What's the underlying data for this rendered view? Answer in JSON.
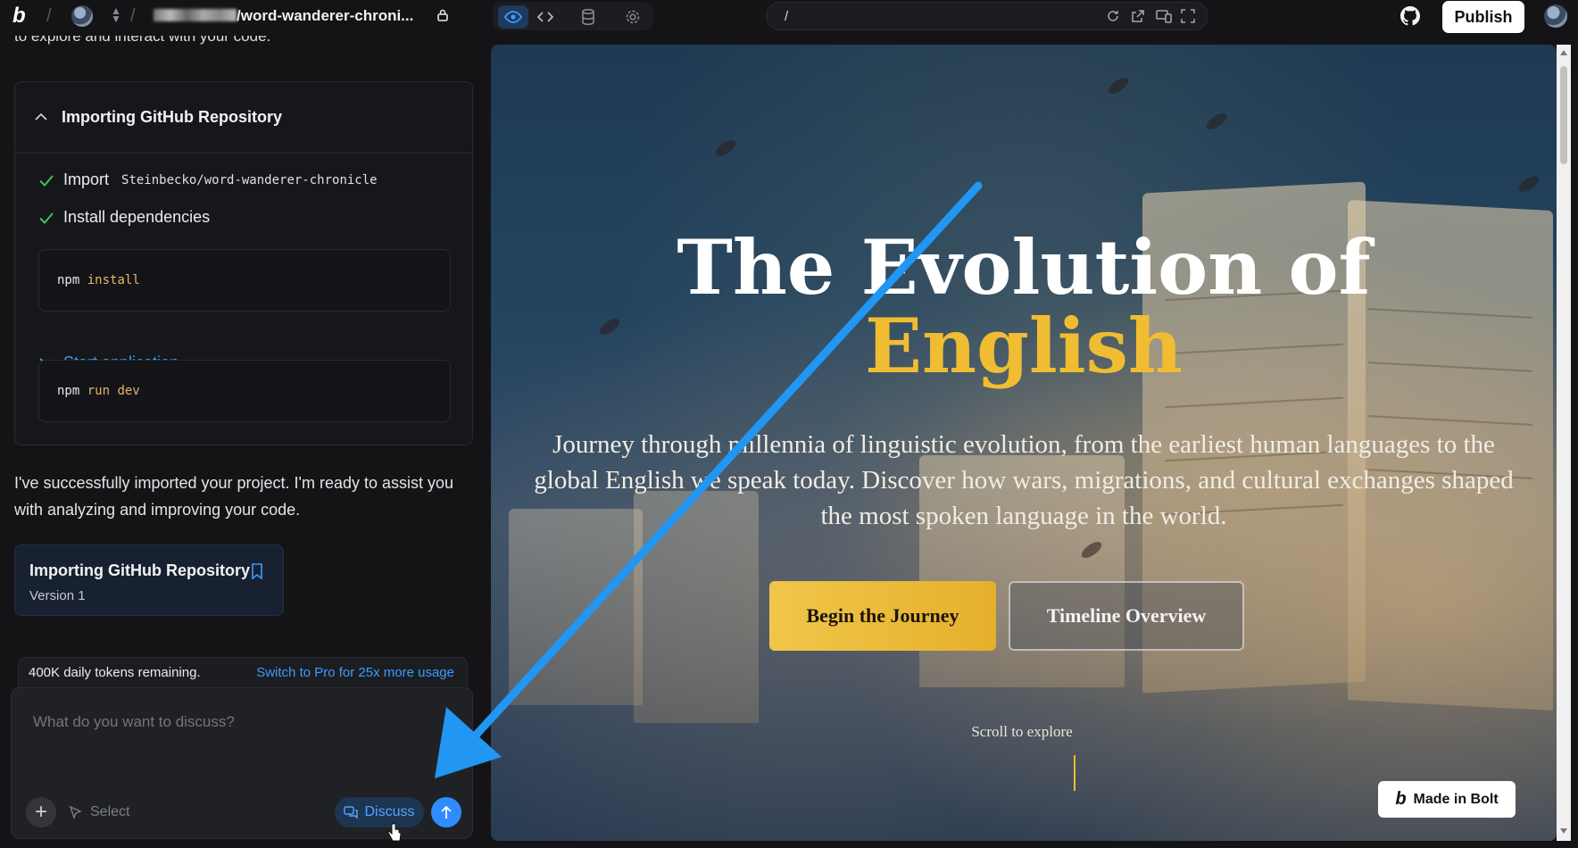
{
  "topbar": {
    "project_path": "/word-wanderer-chroni...",
    "url_path": "/",
    "publish_label": "Publish"
  },
  "chat": {
    "cut_text": "to explore and interact with your code.",
    "import_card": {
      "title": "Importing GitHub Repository",
      "step_import_label": "Import",
      "step_import_repo": "Steinbecko/word-wanderer-chronicle",
      "step_install_label": "Install dependencies",
      "install_cmd": "npm",
      "install_arg": "install",
      "start_label": "Start application",
      "start_cmd": "npm",
      "start_arg": "run dev"
    },
    "reply": "I've successfully imported your project. I'm ready to assist you with analyzing and improving your code.",
    "version_card": {
      "title": "Importing GitHub Repository",
      "version": "Version 1"
    }
  },
  "composer": {
    "tokens_remaining": "400K daily tokens remaining.",
    "upgrade_link": "Switch to Pro for 25x more usage",
    "placeholder": "What do you want to discuss?",
    "select_label": "Select",
    "discuss_label": "Discuss"
  },
  "preview": {
    "hero_title": "The Evolution of",
    "hero_accent": "English",
    "hero_sub": "Journey through millennia of linguistic evolution, from the earliest human languages to the global English we speak today. Discover how wars, migrations, and cultural exchanges shaped the most spoken language in the world.",
    "cta_primary": "Begin the Journey",
    "cta_secondary": "Timeline Overview",
    "scroll_hint": "Scroll to explore",
    "badge": "Made in Bolt"
  },
  "colors": {
    "accent_blue": "#3b9cff",
    "hero_gold": "#f0bd32",
    "annotation_arrow": "#2196f3"
  }
}
